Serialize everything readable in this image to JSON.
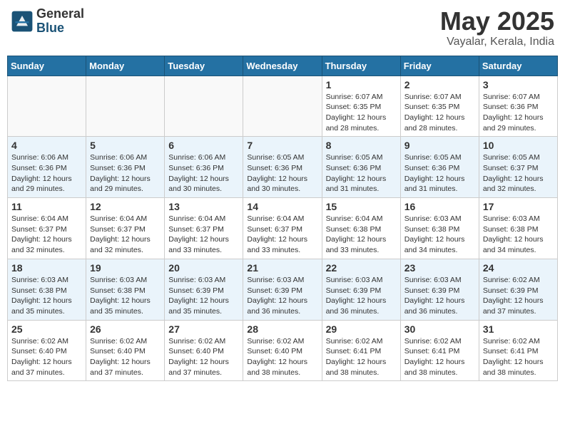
{
  "header": {
    "logo_general": "General",
    "logo_blue": "Blue",
    "month_year": "May 2025",
    "location": "Vayalar, Kerala, India"
  },
  "days_of_week": [
    "Sunday",
    "Monday",
    "Tuesday",
    "Wednesday",
    "Thursday",
    "Friday",
    "Saturday"
  ],
  "weeks": [
    [
      {
        "day": "",
        "info": ""
      },
      {
        "day": "",
        "info": ""
      },
      {
        "day": "",
        "info": ""
      },
      {
        "day": "",
        "info": ""
      },
      {
        "day": "1",
        "info": "Sunrise: 6:07 AM\nSunset: 6:35 PM\nDaylight: 12 hours\nand 28 minutes."
      },
      {
        "day": "2",
        "info": "Sunrise: 6:07 AM\nSunset: 6:35 PM\nDaylight: 12 hours\nand 28 minutes."
      },
      {
        "day": "3",
        "info": "Sunrise: 6:07 AM\nSunset: 6:36 PM\nDaylight: 12 hours\nand 29 minutes."
      }
    ],
    [
      {
        "day": "4",
        "info": "Sunrise: 6:06 AM\nSunset: 6:36 PM\nDaylight: 12 hours\nand 29 minutes."
      },
      {
        "day": "5",
        "info": "Sunrise: 6:06 AM\nSunset: 6:36 PM\nDaylight: 12 hours\nand 29 minutes."
      },
      {
        "day": "6",
        "info": "Sunrise: 6:06 AM\nSunset: 6:36 PM\nDaylight: 12 hours\nand 30 minutes."
      },
      {
        "day": "7",
        "info": "Sunrise: 6:05 AM\nSunset: 6:36 PM\nDaylight: 12 hours\nand 30 minutes."
      },
      {
        "day": "8",
        "info": "Sunrise: 6:05 AM\nSunset: 6:36 PM\nDaylight: 12 hours\nand 31 minutes."
      },
      {
        "day": "9",
        "info": "Sunrise: 6:05 AM\nSunset: 6:36 PM\nDaylight: 12 hours\nand 31 minutes."
      },
      {
        "day": "10",
        "info": "Sunrise: 6:05 AM\nSunset: 6:37 PM\nDaylight: 12 hours\nand 32 minutes."
      }
    ],
    [
      {
        "day": "11",
        "info": "Sunrise: 6:04 AM\nSunset: 6:37 PM\nDaylight: 12 hours\nand 32 minutes."
      },
      {
        "day": "12",
        "info": "Sunrise: 6:04 AM\nSunset: 6:37 PM\nDaylight: 12 hours\nand 32 minutes."
      },
      {
        "day": "13",
        "info": "Sunrise: 6:04 AM\nSunset: 6:37 PM\nDaylight: 12 hours\nand 33 minutes."
      },
      {
        "day": "14",
        "info": "Sunrise: 6:04 AM\nSunset: 6:37 PM\nDaylight: 12 hours\nand 33 minutes."
      },
      {
        "day": "15",
        "info": "Sunrise: 6:04 AM\nSunset: 6:38 PM\nDaylight: 12 hours\nand 33 minutes."
      },
      {
        "day": "16",
        "info": "Sunrise: 6:03 AM\nSunset: 6:38 PM\nDaylight: 12 hours\nand 34 minutes."
      },
      {
        "day": "17",
        "info": "Sunrise: 6:03 AM\nSunset: 6:38 PM\nDaylight: 12 hours\nand 34 minutes."
      }
    ],
    [
      {
        "day": "18",
        "info": "Sunrise: 6:03 AM\nSunset: 6:38 PM\nDaylight: 12 hours\nand 35 minutes."
      },
      {
        "day": "19",
        "info": "Sunrise: 6:03 AM\nSunset: 6:38 PM\nDaylight: 12 hours\nand 35 minutes."
      },
      {
        "day": "20",
        "info": "Sunrise: 6:03 AM\nSunset: 6:39 PM\nDaylight: 12 hours\nand 35 minutes."
      },
      {
        "day": "21",
        "info": "Sunrise: 6:03 AM\nSunset: 6:39 PM\nDaylight: 12 hours\nand 36 minutes."
      },
      {
        "day": "22",
        "info": "Sunrise: 6:03 AM\nSunset: 6:39 PM\nDaylight: 12 hours\nand 36 minutes."
      },
      {
        "day": "23",
        "info": "Sunrise: 6:03 AM\nSunset: 6:39 PM\nDaylight: 12 hours\nand 36 minutes."
      },
      {
        "day": "24",
        "info": "Sunrise: 6:02 AM\nSunset: 6:39 PM\nDaylight: 12 hours\nand 37 minutes."
      }
    ],
    [
      {
        "day": "25",
        "info": "Sunrise: 6:02 AM\nSunset: 6:40 PM\nDaylight: 12 hours\nand 37 minutes."
      },
      {
        "day": "26",
        "info": "Sunrise: 6:02 AM\nSunset: 6:40 PM\nDaylight: 12 hours\nand 37 minutes."
      },
      {
        "day": "27",
        "info": "Sunrise: 6:02 AM\nSunset: 6:40 PM\nDaylight: 12 hours\nand 37 minutes."
      },
      {
        "day": "28",
        "info": "Sunrise: 6:02 AM\nSunset: 6:40 PM\nDaylight: 12 hours\nand 38 minutes."
      },
      {
        "day": "29",
        "info": "Sunrise: 6:02 AM\nSunset: 6:41 PM\nDaylight: 12 hours\nand 38 minutes."
      },
      {
        "day": "30",
        "info": "Sunrise: 6:02 AM\nSunset: 6:41 PM\nDaylight: 12 hours\nand 38 minutes."
      },
      {
        "day": "31",
        "info": "Sunrise: 6:02 AM\nSunset: 6:41 PM\nDaylight: 12 hours\nand 38 minutes."
      }
    ]
  ]
}
